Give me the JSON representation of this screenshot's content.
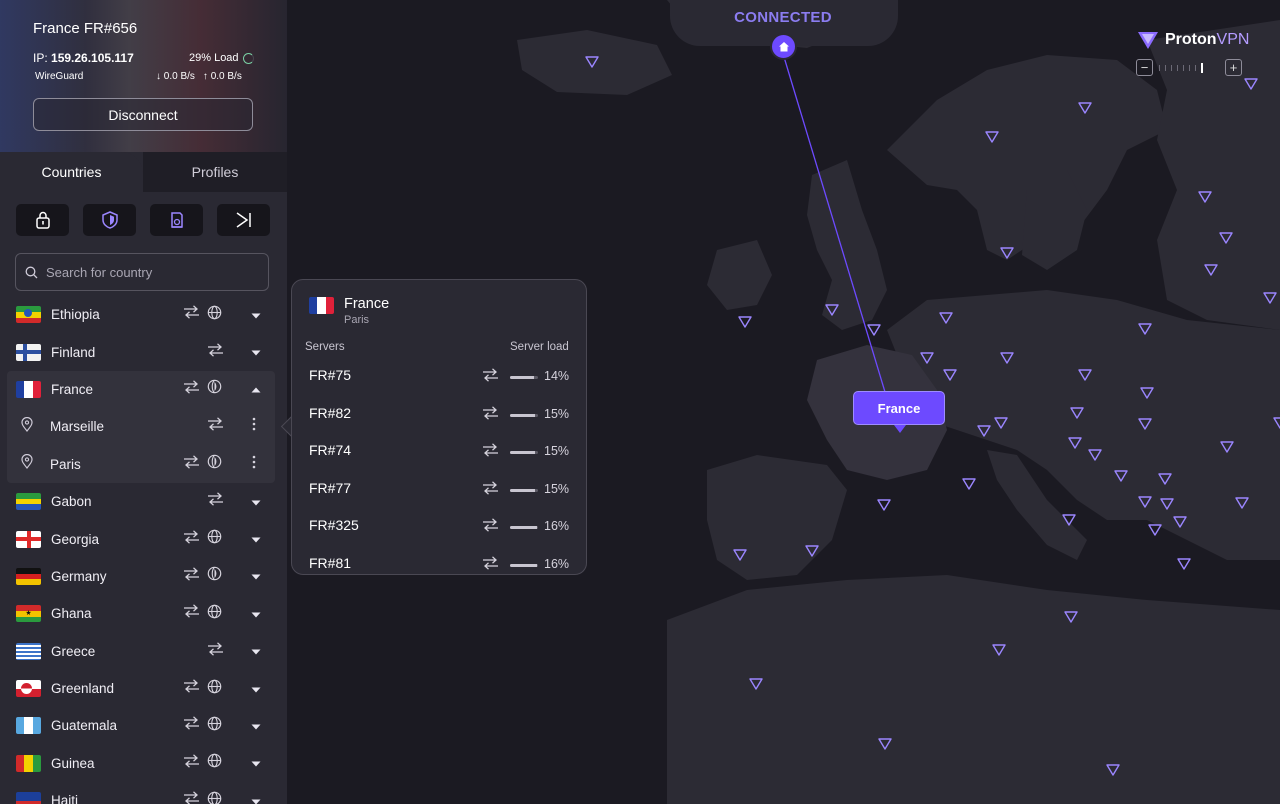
{
  "connection": {
    "title": "France FR#656",
    "ip_label": "IP:",
    "ip": "159.26.105.117",
    "load": "29% Load",
    "protocol": "WireGuard",
    "download": "0.0 B/s",
    "upload": "0.0 B/s",
    "disconnect_label": "Disconnect"
  },
  "tabs": {
    "countries": "Countries",
    "profiles": "Profiles"
  },
  "filters": [
    "lock-icon",
    "shield-icon",
    "tor-icon",
    "arrow-in-icon"
  ],
  "search": {
    "placeholder": "Search for country"
  },
  "countries": [
    {
      "name": "Ethiopia",
      "features": [
        "p2p",
        "globe"
      ],
      "expanded": false
    },
    {
      "name": "Finland",
      "features": [
        "p2p"
      ],
      "expanded": false
    },
    {
      "name": "France",
      "features": [
        "p2p",
        "tor"
      ],
      "expanded": true
    },
    {
      "name": "Gabon",
      "features": [
        "p2p"
      ],
      "expanded": false
    },
    {
      "name": "Georgia",
      "features": [
        "p2p",
        "globe"
      ],
      "expanded": false
    },
    {
      "name": "Germany",
      "features": [
        "p2p",
        "tor"
      ],
      "expanded": false
    },
    {
      "name": "Ghana",
      "features": [
        "p2p",
        "globe"
      ],
      "expanded": false
    },
    {
      "name": "Greece",
      "features": [
        "p2p"
      ],
      "expanded": false
    },
    {
      "name": "Greenland",
      "features": [
        "p2p",
        "globe"
      ],
      "expanded": false
    },
    {
      "name": "Guatemala",
      "features": [
        "p2p",
        "globe"
      ],
      "expanded": false
    },
    {
      "name": "Guinea",
      "features": [
        "p2p",
        "globe"
      ],
      "expanded": false
    },
    {
      "name": "Haiti",
      "features": [
        "p2p",
        "globe"
      ],
      "expanded": false
    }
  ],
  "france_cities": [
    {
      "name": "Marseille",
      "features": [
        "p2p"
      ]
    },
    {
      "name": "Paris",
      "features": [
        "p2p",
        "tor"
      ]
    }
  ],
  "map": {
    "status": "CONNECTED",
    "brand_proton": "Proton",
    "brand_vpn": "VPN",
    "country_tag": "France"
  },
  "popup": {
    "country": "France",
    "city": "Paris",
    "header_servers": "Servers",
    "header_load": "Server load",
    "servers": [
      {
        "name": "FR#75",
        "load": "14%",
        "load_value": 14
      },
      {
        "name": "FR#82",
        "load": "15%",
        "load_value": 15
      },
      {
        "name": "FR#74",
        "load": "15%",
        "load_value": 15
      },
      {
        "name": "FR#77",
        "load": "15%",
        "load_value": 15
      },
      {
        "name": "FR#325",
        "load": "16%",
        "load_value": 16
      },
      {
        "name": "FR#81",
        "load": "16%",
        "load_value": 16
      }
    ]
  },
  "colors": {
    "accent": "#6d4aff",
    "status": "#8b7cf0",
    "load_ok": "#7ad0a4"
  }
}
